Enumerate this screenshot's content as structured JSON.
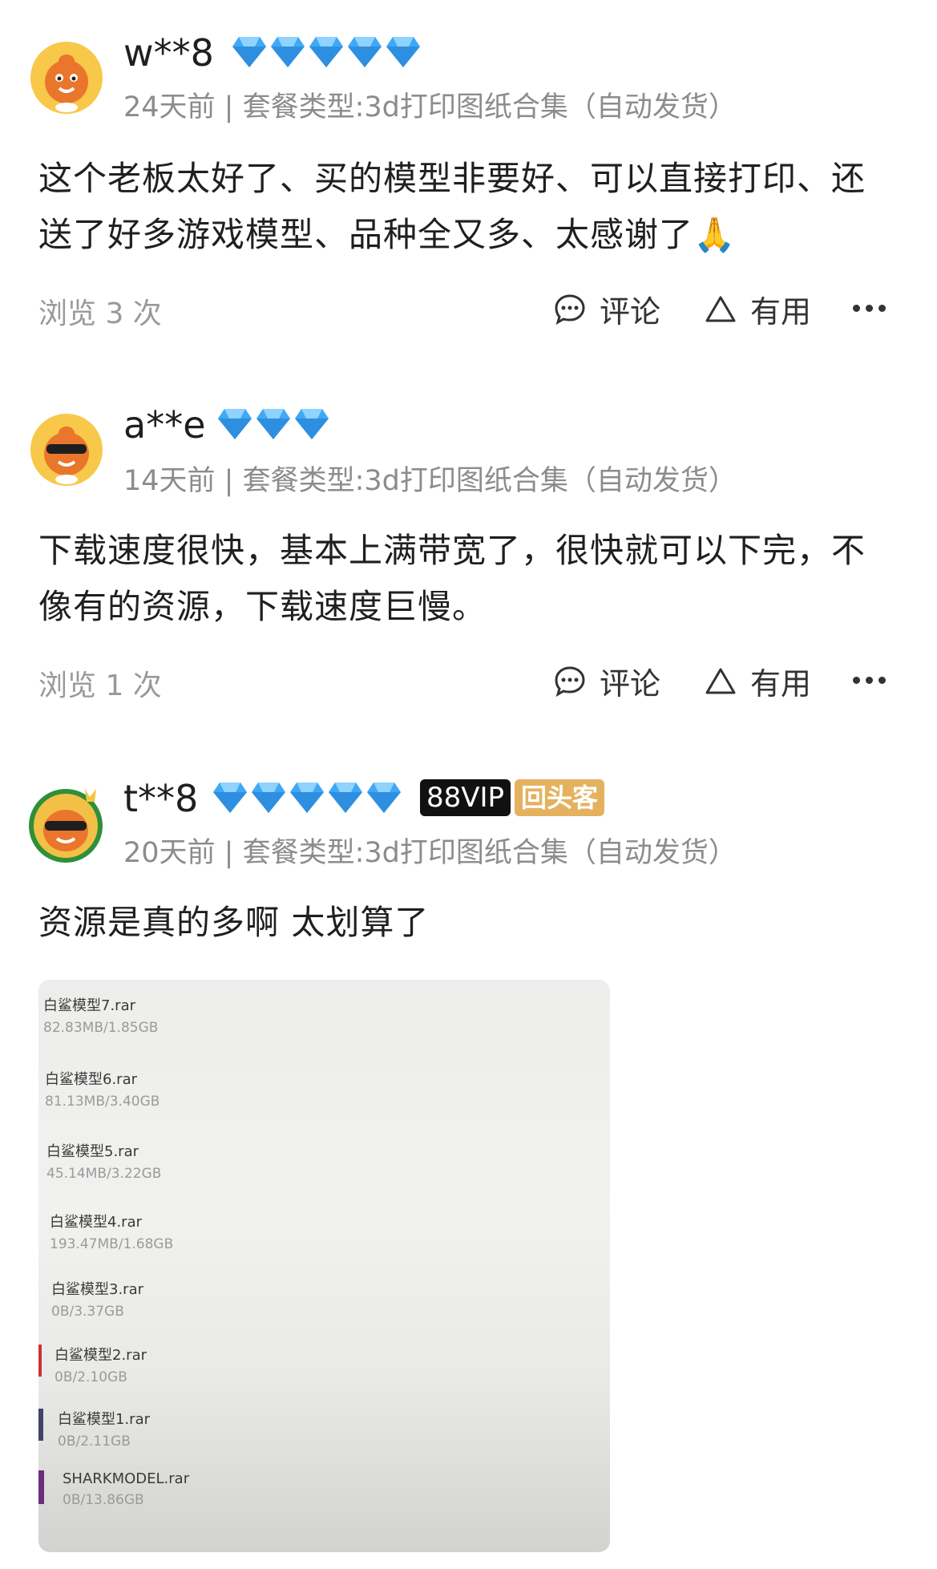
{
  "reviews": [
    {
      "username": "w**8",
      "diamonds": 5,
      "meta": "24天前 | 套餐类型:3d打印图纸合集（自动发货）",
      "text_line1": "这个老板太好了、买的模型非要好、可以直接打印、还",
      "text_line2": "送了好多游戏模型、品种全又多、太感谢了🙏",
      "views": "浏览 3 次",
      "comment_label": "评论",
      "useful_label": "有用"
    },
    {
      "username": "a**e",
      "diamonds": 3,
      "meta": "14天前 | 套餐类型:3d打印图纸合集（自动发货）",
      "text_line1": "下载速度很快，基本上满带宽了，很快就可以下完，不",
      "text_line2": "像有的资源，下载速度巨慢。",
      "views": "浏览 1 次",
      "comment_label": "评论",
      "useful_label": "有用"
    },
    {
      "username": "t**8",
      "diamonds": 5,
      "vip_badge": "88VIP",
      "repeat_badge": "回头客",
      "meta": "20天前 | 套餐类型:3d打印图纸合集（自动发货）",
      "text_line1": "资源是真的多啊 太划算了"
    }
  ],
  "photo": {
    "files": [
      {
        "name": "白鲨模型7.rar",
        "size": "82.83MB/1.85GB"
      },
      {
        "name": "白鲨模型6.rar",
        "size": "81.13MB/3.40GB"
      },
      {
        "name": "白鲨模型5.rar",
        "size": "45.14MB/3.22GB"
      },
      {
        "name": "白鲨模型4.rar",
        "size": "193.47MB/1.68GB"
      },
      {
        "name": "白鲨模型3.rar",
        "size": "0B/3.37GB"
      },
      {
        "name": "白鲨模型2.rar",
        "size": "0B/2.10GB"
      },
      {
        "name": "白鲨模型1.rar",
        "size": "0B/2.11GB"
      },
      {
        "name": "SHARKMODEL.rar",
        "size": "0B/13.86GB"
      }
    ]
  },
  "colors": {
    "diamond": "#3fa9f5",
    "meta_text": "#8c8c8c",
    "vip_bg": "#111111",
    "repeat_bg": "#e4b25f"
  },
  "icons": [
    "avatar-icon",
    "diamond-icon",
    "comment-icon",
    "useful-icon",
    "more-icon"
  ]
}
